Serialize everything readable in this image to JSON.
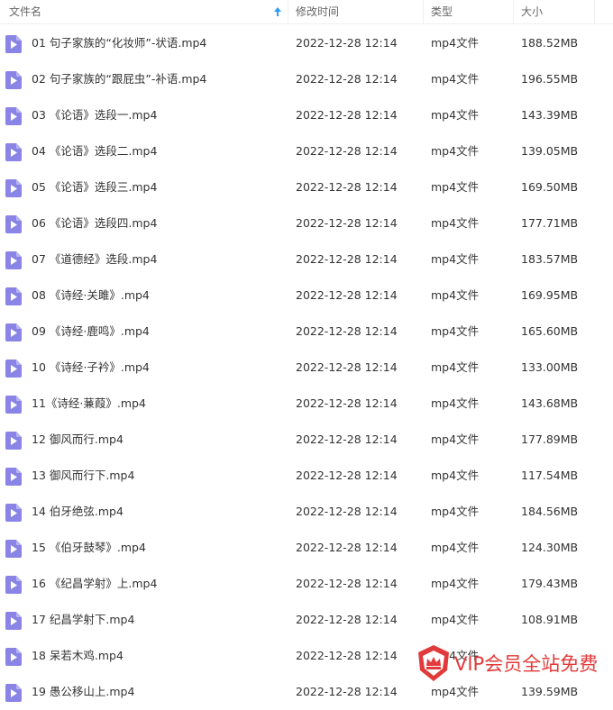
{
  "header": {
    "col_name": "文件名",
    "col_date": "修改时间",
    "col_type": "类型",
    "col_size": "大小",
    "sort_icon": "arrow-up-icon"
  },
  "colors": {
    "file_icon": "#8a84e6",
    "sort_arrow": "#2a9df4",
    "watermark": "#e23a3a"
  },
  "files": [
    {
      "name": "01 句子家族的“化妆师”-状语.mp4",
      "date": "2022-12-28 12:14",
      "type": "mp4文件",
      "size": "188.52MB"
    },
    {
      "name": "02 句子家族的“跟屁虫”-补语.mp4",
      "date": "2022-12-28 12:14",
      "type": "mp4文件",
      "size": "196.55MB"
    },
    {
      "name": "03 《论语》选段一.mp4",
      "date": "2022-12-28 12:14",
      "type": "mp4文件",
      "size": "143.39MB"
    },
    {
      "name": "04 《论语》选段二.mp4",
      "date": "2022-12-28 12:14",
      "type": "mp4文件",
      "size": "139.05MB"
    },
    {
      "name": "05 《论语》选段三.mp4",
      "date": "2022-12-28 12:14",
      "type": "mp4文件",
      "size": "169.50MB"
    },
    {
      "name": "06 《论语》选段四.mp4",
      "date": "2022-12-28 12:14",
      "type": "mp4文件",
      "size": "177.71MB"
    },
    {
      "name": "07 《道德经》选段.mp4",
      "date": "2022-12-28 12:14",
      "type": "mp4文件",
      "size": "183.57MB"
    },
    {
      "name": "08 《诗经·关雎》.mp4",
      "date": "2022-12-28 12:14",
      "type": "mp4文件",
      "size": "169.95MB"
    },
    {
      "name": "09 《诗经·鹿鸣》.mp4",
      "date": "2022-12-28 12:14",
      "type": "mp4文件",
      "size": "165.60MB"
    },
    {
      "name": "10 《诗经·子衿》.mp4",
      "date": "2022-12-28 12:14",
      "type": "mp4文件",
      "size": "133.00MB"
    },
    {
      "name": "11《诗经·蒹葭》.mp4",
      "date": "2022-12-28 12:14",
      "type": "mp4文件",
      "size": "143.68MB"
    },
    {
      "name": "12 御风而行.mp4",
      "date": "2022-12-28 12:14",
      "type": "mp4文件",
      "size": "177.89MB"
    },
    {
      "name": "13 御风而行下.mp4",
      "date": "2022-12-28 12:14",
      "type": "mp4文件",
      "size": "117.54MB"
    },
    {
      "name": "14 伯牙绝弦.mp4",
      "date": "2022-12-28 12:14",
      "type": "mp4文件",
      "size": "184.56MB"
    },
    {
      "name": "15 《伯牙鼓琴》.mp4",
      "date": "2022-12-28 12:14",
      "type": "mp4文件",
      "size": "124.30MB"
    },
    {
      "name": "16 《纪昌学射》上.mp4",
      "date": "2022-12-28 12:14",
      "type": "mp4文件",
      "size": "179.43MB"
    },
    {
      "name": "17 纪昌学射下.mp4",
      "date": "2022-12-28 12:14",
      "type": "mp4文件",
      "size": "108.91MB"
    },
    {
      "name": "18 呆若木鸡.mp4",
      "date": "2022-12-28 12:14",
      "type": "mp4文件",
      "size": ""
    },
    {
      "name": "19 愚公移山上.mp4",
      "date": "2022-12-28 12:14",
      "type": "mp4文件",
      "size": "139.59MB"
    }
  ],
  "watermark": {
    "text": "VIP会员全站免费",
    "icon": "crown-badge-icon"
  }
}
